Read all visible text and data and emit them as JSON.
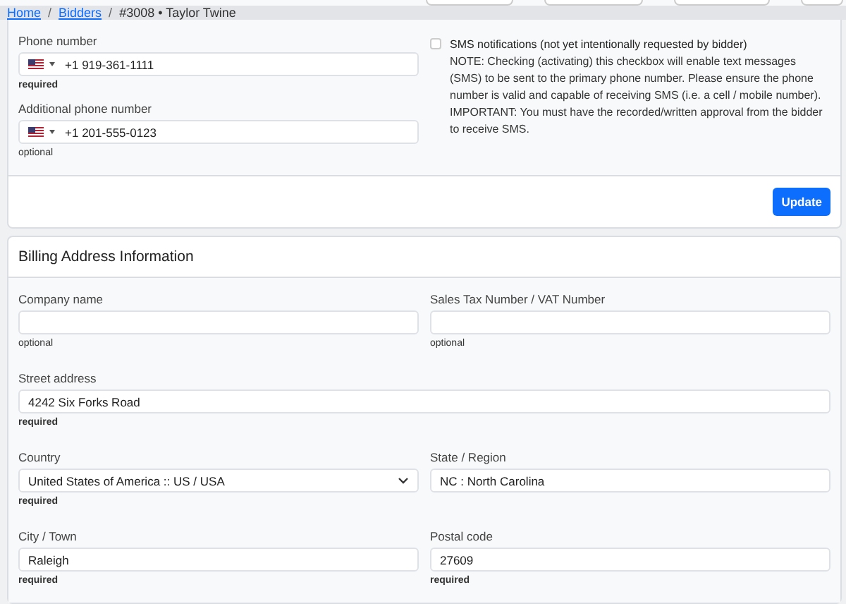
{
  "breadcrumb": [
    {
      "label": "Home",
      "kind": "link"
    },
    {
      "label": "/",
      "kind": "separator"
    },
    {
      "label": "Bidders",
      "kind": "link"
    },
    {
      "label": "/",
      "kind": "separator"
    },
    {
      "label": "#3008 • Taylor Twine",
      "kind": "current"
    }
  ],
  "phones": [
    {
      "label": "Phone number",
      "dial_code": "+1",
      "value": "919-361-1111",
      "hint": "required",
      "required": true
    },
    {
      "label": "Additional phone number",
      "dial_code": "+1",
      "value": "201-555-0123",
      "hint": "optional",
      "required": false
    }
  ],
  "sms": {
    "checked": false,
    "label": "SMS notifications (not yet intentionally requested by bidder)",
    "notes": [
      "NOTE: Checking (activating) this checkbox will enable text messages (SMS) to be sent to the primary phone number. Please ensure the phone number is valid and capable of receiving SMS (i.e. a cell / mobile number).",
      "IMPORTANT: You must have the recorded/written approval from the bidder to receive SMS."
    ]
  },
  "update_button": "Update",
  "billing": {
    "title": "Billing Address Information",
    "rows": [
      [
        {
          "label": "Company name",
          "kind": "text",
          "hint": "optional",
          "required": false
        },
        {
          "label": "Sales Tax Number / VAT Number",
          "kind": "text",
          "hint": "optional",
          "required": false
        }
      ],
      [
        {
          "label": "Street address",
          "kind": "text",
          "value": "4242 Six Forks Road",
          "hint": "required",
          "required": true
        }
      ],
      [
        {
          "label": "Country",
          "kind": "select",
          "value": "United States of America :: US / USA",
          "hint": "required",
          "required": true
        },
        {
          "label": "State / Region",
          "kind": "text",
          "value": "NC : North Carolina"
        }
      ],
      [
        {
          "label": "City / Town",
          "kind": "text",
          "value": "Raleigh",
          "hint": "required",
          "required": true
        },
        {
          "label": "Postal code",
          "kind": "text",
          "value": "27609",
          "hint": "required",
          "required": true
        }
      ]
    ]
  }
}
